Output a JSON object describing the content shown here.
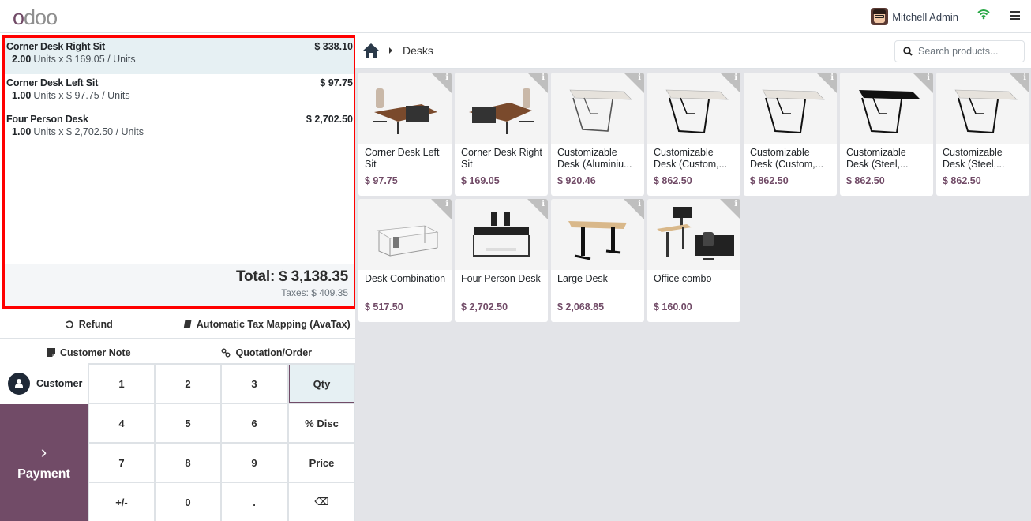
{
  "header": {
    "logo": "odoo",
    "user_name": "Mitchell Admin",
    "icons": [
      "wifi-icon",
      "menu-icon"
    ]
  },
  "order": {
    "lines": [
      {
        "name": "Corner Desk Right Sit",
        "qty": "2.00",
        "detail": "Units x $ 169.05 / Units",
        "price": "$ 338.10",
        "selected": true
      },
      {
        "name": "Corner Desk Left Sit",
        "qty": "1.00",
        "detail": "Units x $ 97.75 / Units",
        "price": "$ 97.75",
        "selected": false
      },
      {
        "name": "Four Person Desk",
        "qty": "1.00",
        "detail": "Units x $ 2,702.50 / Units",
        "price": "$ 2,702.50",
        "selected": false
      }
    ],
    "total": "Total: $ 3,138.35",
    "taxes": "Taxes: $ 409.35"
  },
  "controls": {
    "refund": "Refund",
    "tax_mapping": "Automatic Tax Mapping (AvaTax)",
    "customer_note": "Customer Note",
    "quotation": "Quotation/Order"
  },
  "numpad": {
    "customer": "Customer",
    "payment": "Payment",
    "keys": [
      "1",
      "2",
      "3",
      "Qty",
      "4",
      "5",
      "6",
      "% Disc",
      "7",
      "8",
      "9",
      "Price",
      "+/-",
      "0",
      ".",
      "⌫"
    ],
    "active_mode": "Qty"
  },
  "products_pane": {
    "breadcrumb": "Desks",
    "search_placeholder": "Search products...",
    "products": [
      {
        "name": "Corner Desk Left Sit",
        "price": "$ 97.75",
        "img": "corner-left"
      },
      {
        "name": "Corner Desk Right Sit",
        "price": "$ 169.05",
        "img": "corner-right"
      },
      {
        "name": "Customizable Desk (Aluminiu...",
        "price": "$ 920.46",
        "img": "table-alu"
      },
      {
        "name": "Customizable Desk (Custom,...",
        "price": "$ 862.50",
        "img": "table-black"
      },
      {
        "name": "Customizable Desk (Custom,...",
        "price": "$ 862.50",
        "img": "table-black"
      },
      {
        "name": "Customizable Desk (Steel,...",
        "price": "$ 862.50",
        "img": "table-dark"
      },
      {
        "name": "Customizable Desk (Steel,...",
        "price": "$ 862.50",
        "img": "table-black"
      },
      {
        "name": "Desk Combination",
        "price": "$ 517.50",
        "img": "combo-white"
      },
      {
        "name": "Four Person Desk",
        "price": "$ 2,702.50",
        "img": "four-person"
      },
      {
        "name": "Large Desk",
        "price": "$ 2,068.85",
        "img": "large-desk"
      },
      {
        "name": "Office combo",
        "price": "$ 160.00",
        "img": "office-combo"
      }
    ]
  },
  "colors": {
    "brand": "#714b67",
    "selected_line": "#e6f0f3",
    "highlight_border": "#ff0000",
    "wifi": "#28a745"
  }
}
